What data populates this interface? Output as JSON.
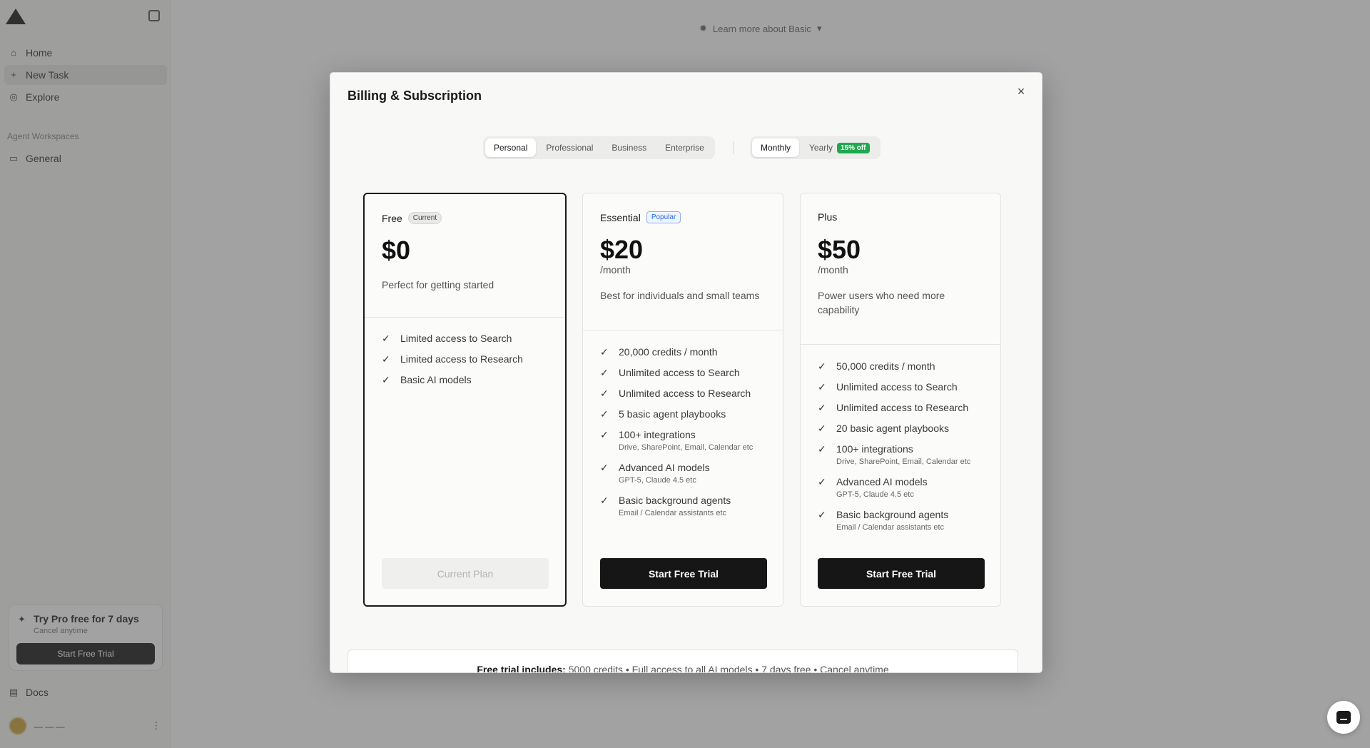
{
  "background": {
    "nav": [
      {
        "label": "Home",
        "icon": "home-icon"
      },
      {
        "label": "New Task",
        "icon": "plus-icon"
      },
      {
        "label": "Explore",
        "icon": "compass-icon"
      }
    ],
    "section_label": "Agent Workspaces",
    "workspace": "General",
    "promo": {
      "title": "Try Pro free for 7 days",
      "subtitle": "Cancel anytime",
      "button": "Start Free Trial"
    },
    "docs": "Docs",
    "topbar_hint": "Learn more about Basic"
  },
  "modal": {
    "title": "Billing & Subscription",
    "close": "×",
    "plan_tabs": [
      {
        "label": "Personal",
        "active": true
      },
      {
        "label": "Professional",
        "active": false
      },
      {
        "label": "Business",
        "active": false
      },
      {
        "label": "Enterprise",
        "active": false
      }
    ],
    "billing_toggle": {
      "monthly": "Monthly",
      "yearly": "Yearly",
      "discount": "15% off",
      "selected": "Monthly"
    },
    "plans": [
      {
        "name": "Free",
        "badge": "Current",
        "price": "$0",
        "period": "",
        "description": "Perfect for getting started",
        "features": [
          {
            "text": "Limited access to Search",
            "sub": ""
          },
          {
            "text": "Limited access to Research",
            "sub": ""
          },
          {
            "text": "Basic AI models",
            "sub": ""
          }
        ],
        "button": "Current Plan"
      },
      {
        "name": "Essential",
        "badge": "Popular",
        "price": "$20",
        "period": "/month",
        "description": "Best for individuals and small teams",
        "features": [
          {
            "text": "20,000 credits / month",
            "sub": ""
          },
          {
            "text": "Unlimited access to Search",
            "sub": ""
          },
          {
            "text": "Unlimited access to Research",
            "sub": ""
          },
          {
            "text": "5 basic agent playbooks",
            "sub": ""
          },
          {
            "text": "100+ integrations",
            "sub": "Drive, SharePoint, Email, Calendar etc"
          },
          {
            "text": "Advanced AI models",
            "sub": "GPT-5, Claude 4.5 etc"
          },
          {
            "text": "Basic background agents",
            "sub": "Email / Calendar assistants etc"
          }
        ],
        "button": "Start Free Trial"
      },
      {
        "name": "Plus",
        "badge": "",
        "price": "$50",
        "period": "/month",
        "description": "Power users who need more capability",
        "features": [
          {
            "text": "50,000 credits / month",
            "sub": ""
          },
          {
            "text": "Unlimited access to Search",
            "sub": ""
          },
          {
            "text": "Unlimited access to Research",
            "sub": ""
          },
          {
            "text": "20 basic agent playbooks",
            "sub": ""
          },
          {
            "text": "100+ integrations",
            "sub": "Drive, SharePoint, Email, Calendar etc"
          },
          {
            "text": "Advanced AI models",
            "sub": "GPT-5, Claude 4.5 etc"
          },
          {
            "text": "Basic background agents",
            "sub": "Email / Calendar assistants etc"
          }
        ],
        "button": "Start Free Trial"
      }
    ],
    "trial_note": {
      "label": "Free trial includes:",
      "text": "5000 credits • Full access to all AI models • 7 days free • Cancel anytime"
    }
  },
  "chat_widget_icon": "chat-icon"
}
